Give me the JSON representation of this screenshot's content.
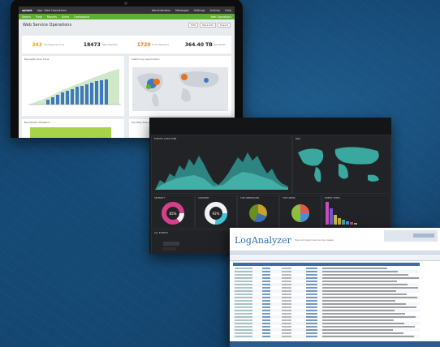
{
  "laptop": {
    "appbar": {
      "logo": "splunk",
      "items": [
        "App: Web Operations",
        "Administrator",
        "Messages",
        "Settings",
        "Activity",
        "Help"
      ]
    },
    "navbar": {
      "items": [
        "Search",
        "Pivot",
        "Reports",
        "Alerts",
        "Dashboards"
      ],
      "right": "Web Operations"
    },
    "dashboard_title": "Web Service Operations",
    "header_buttons": [
      "Edit",
      "More Info",
      "Export"
    ],
    "stats": [
      {
        "value": "243",
        "label": "Avg Response Time",
        "color": "#f0a30a"
      },
      {
        "value": "18473",
        "label": "Total Requests",
        "color": "#222222"
      },
      {
        "value": "1720",
        "label": "Errors Reported",
        "color": "#e8731a"
      },
      {
        "value": "364.40 TB",
        "label": "Bandwidth",
        "color": "#222222"
      }
    ],
    "panels": [
      "Requests Over Time",
      "Visitors by Geolocation",
      "Bandwidth Utilization",
      "Top Http Status Codes"
    ]
  },
  "dark_dashboard": {
    "panels": [
      "EVENTS OVER TIME",
      "MAP",
      "SEVERITY",
      "COUNTRY",
      "TOP OPERATORS",
      "TOP USERS",
      "EVENT TYPES",
      "ALL EVENTS"
    ],
    "donut_center": [
      "85%",
      "92%"
    ]
  },
  "log_analyzer": {
    "brand": "LogAnalyzer",
    "tagline": "free and open source log viewer"
  }
}
